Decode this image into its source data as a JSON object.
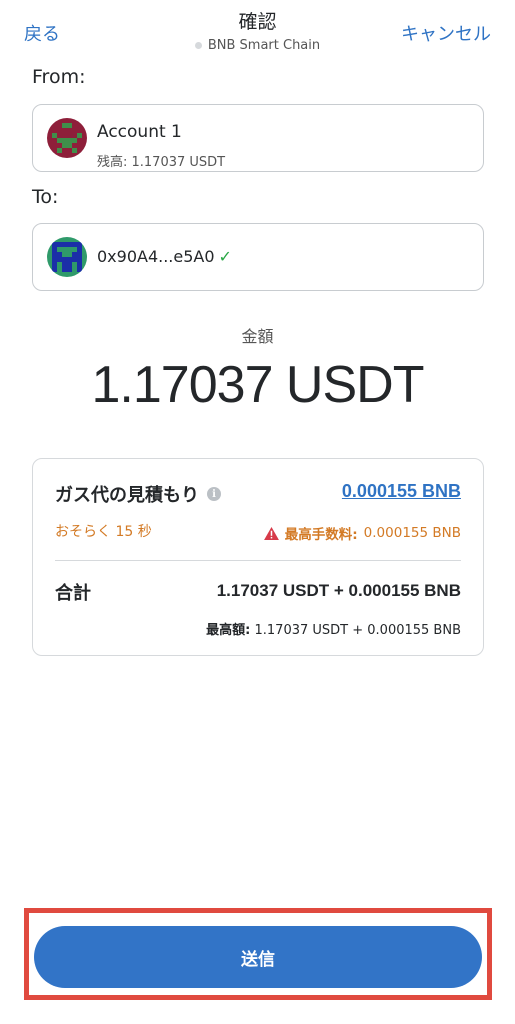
{
  "header": {
    "back_label": "戻る",
    "title": "確認",
    "network": "BNB Smart Chain",
    "cancel_label": "キャンセル"
  },
  "from": {
    "label": "From:",
    "account_name": "Account 1",
    "balance": "残高: 1.17037 USDT"
  },
  "to": {
    "label": "To:",
    "address": "0x90A4...e5A0",
    "check": "✓"
  },
  "amount": {
    "label": "金額",
    "value": "1.17037 USDT"
  },
  "gas": {
    "title": "ガス代の見積もり",
    "info_icon": "i",
    "amount": "0.000155 BNB",
    "time": "おそらく 15 秒",
    "max_fee_label": "最高手数料:",
    "max_fee_value": "0.000155 BNB"
  },
  "total": {
    "label": "合計",
    "value": "1.17037 USDT + 0.000155 BNB",
    "max_label": "最高額:",
    "max_value": "1.17037 USDT + 0.000155 BNB"
  },
  "send_label": "送信",
  "colors": {
    "accent": "#2f73c4",
    "warning": "#d37a25",
    "highlight": "#e04a3f"
  }
}
